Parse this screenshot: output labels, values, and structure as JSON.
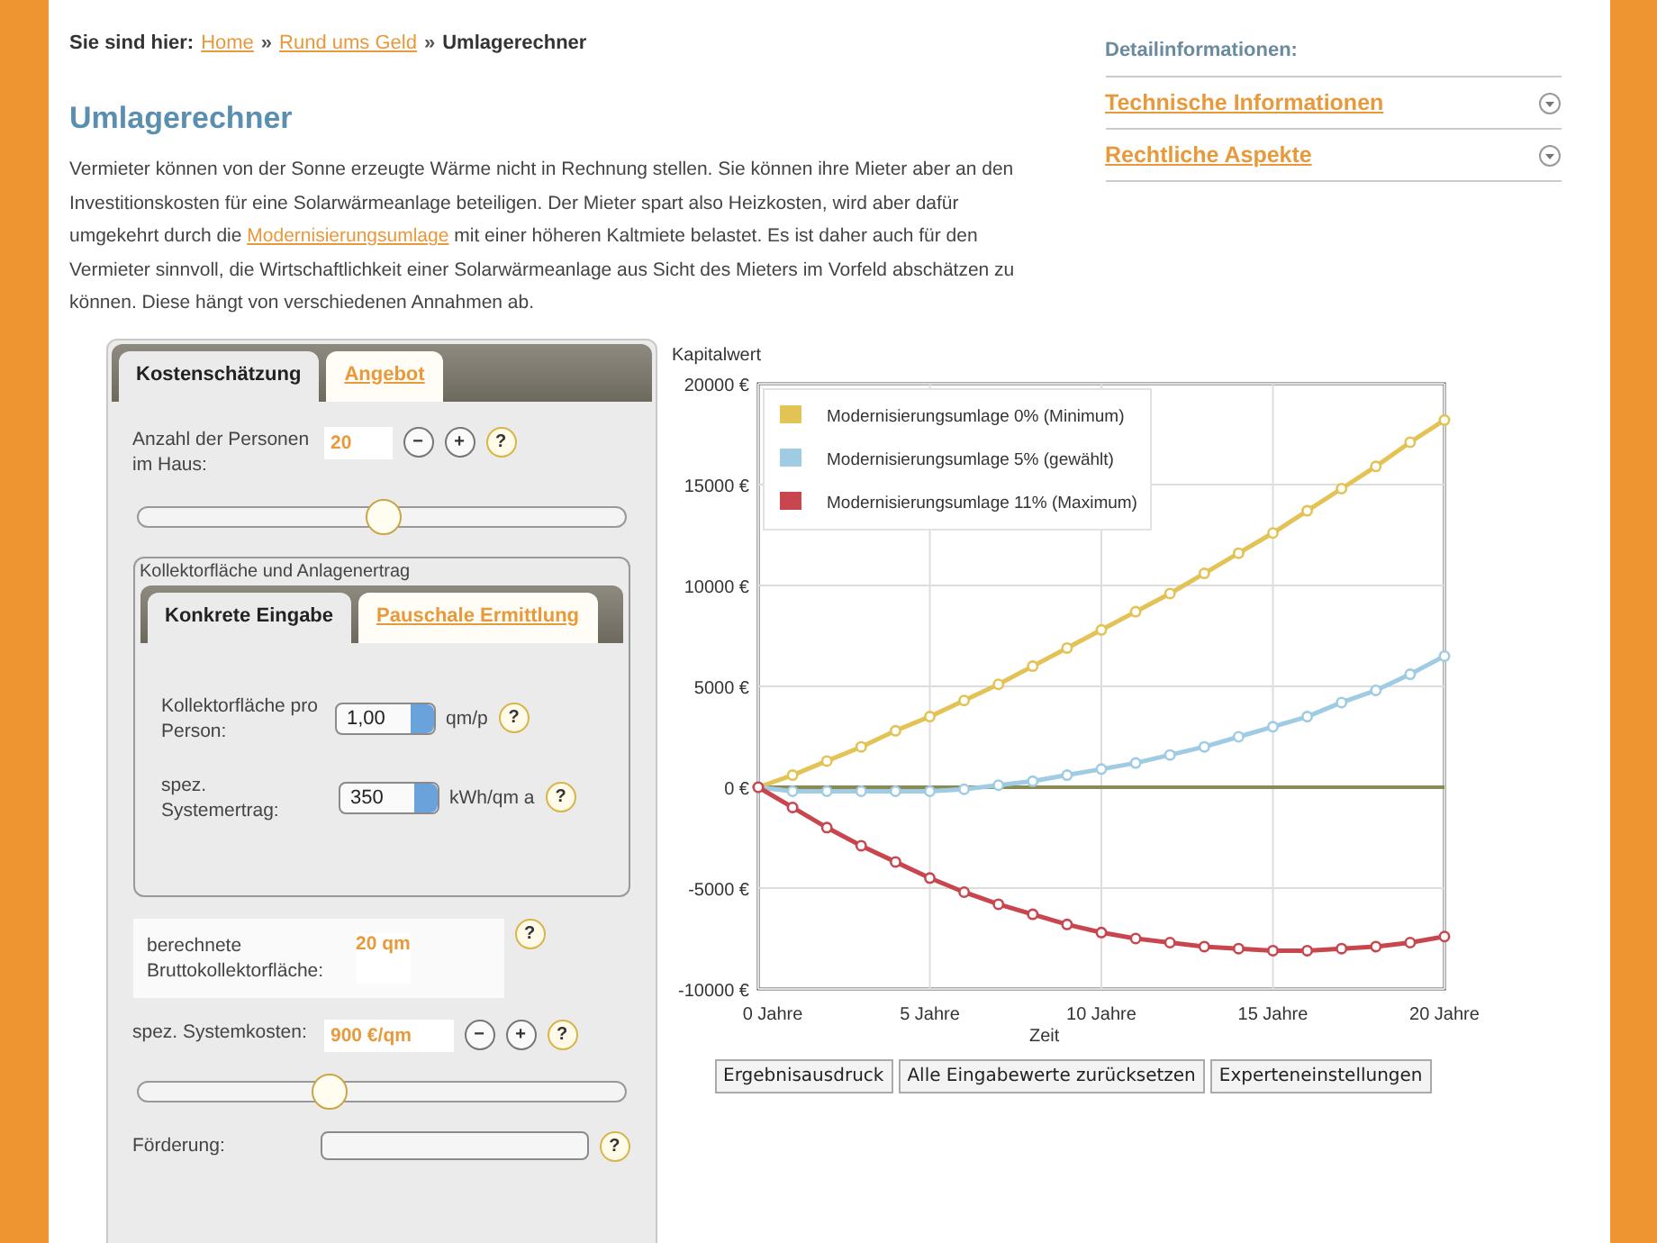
{
  "breadcrumb": {
    "label": "Sie sind hier:",
    "items": [
      {
        "text": "Home",
        "kind": "link"
      },
      {
        "text": "»",
        "kind": "separator"
      },
      {
        "text": "Rund ums Geld",
        "kind": "link"
      },
      {
        "text": "»",
        "kind": "separator"
      },
      {
        "text": "Umlagerechner",
        "kind": "current"
      }
    ]
  },
  "title": "Umlagerechner",
  "intro": [
    {
      "text": "Vermieter können von der Sonne erzeugte Wärme nicht in Rechnung stellen. Sie können ihre Mieter aber an den Investitionskosten für eine Solarwärmeanlage beteiligen. Der Mieter spart also Heizkosten, wird aber dafür umgekehrt durch die ",
      "kind": "text"
    },
    {
      "text": "Modernisierungsumlage",
      "kind": "link"
    },
    {
      "text": " mit einer höheren Kaltmiete belastet. Es ist daher auch für den Vermieter sinnvoll, die Wirtschaftlichkeit einer Solarwärmeanlage aus Sicht des Mieters im Vorfeld abschätzen zu können. Diese hängt von verschiedenen Annahmen ab.",
      "kind": "text"
    }
  ],
  "sidebar": {
    "heading": "Detailinformationen:",
    "items": [
      {
        "label": "Technische Informationen",
        "expanded": false
      },
      {
        "label": "Rechtliche Aspekte",
        "expanded": false
      }
    ]
  },
  "calculator": {
    "tabs": [
      {
        "label": "Kostenschätzung",
        "selected": true
      },
      {
        "label": "Angebot",
        "selected": false
      }
    ],
    "rows": [
      {
        "kind": "stepper",
        "label": "Anzahl der Personen im Haus:",
        "value": "20",
        "buttons": [
          "−",
          "+",
          "?"
        ]
      },
      {
        "kind": "slider",
        "level": 0.5
      },
      {
        "kind": "group",
        "legend": "Kollektorfläche und Anlagenertrag",
        "tabs": [
          {
            "label": "Konkrete Eingabe",
            "selected": true
          },
          {
            "label": "Pauschale Ermittlung",
            "selected": false
          }
        ],
        "fields": [
          {
            "label": "Kollektorfläche pro Person:",
            "value": "1,00",
            "unit": "qm/p",
            "help": "?"
          },
          {
            "label": "spez. Systemertrag:",
            "value": "350",
            "unit": "kWh/qm a",
            "help": "?"
          }
        ]
      },
      {
        "kind": "result",
        "label": "berechnete Bruttokollektorfläche:",
        "value": "20 qm",
        "buttons": [
          "?"
        ]
      },
      {
        "kind": "stepper",
        "label": "spez. Systemkosten:",
        "value": "900 €/qm",
        "buttons": [
          "−",
          "+",
          "?"
        ]
      },
      {
        "kind": "slider",
        "level": 0.39
      },
      {
        "kind": "select",
        "label": "Förderung:",
        "buttons": [
          "?"
        ]
      }
    ]
  },
  "chart": {
    "chart_data": {
      "type": "line",
      "ylabel": "Kapitalwert",
      "xlabel": "Zeit",
      "x": [
        0,
        1,
        2,
        3,
        4,
        5,
        6,
        7,
        8,
        9,
        10,
        11,
        12,
        13,
        14,
        15,
        16,
        17,
        18,
        19,
        20
      ],
      "xticks": [
        {
          "value": 0,
          "label": "0 Jahre"
        },
        {
          "value": 5,
          "label": "5 Jahre"
        },
        {
          "value": 10,
          "label": "10 Jahre"
        },
        {
          "value": 15,
          "label": "15 Jahre"
        },
        {
          "value": 20,
          "label": "20 Jahre"
        }
      ],
      "yticks": [
        {
          "value": -10000,
          "label": "-10000 €"
        },
        {
          "value": -5000,
          "label": "-5000 €"
        },
        {
          "value": 0,
          "label": "0 €"
        },
        {
          "value": 5000,
          "label": "5000 €"
        },
        {
          "value": 10000,
          "label": "10000 €"
        },
        {
          "value": 15000,
          "label": "15000 €"
        },
        {
          "value": 20000,
          "label": "20000 €"
        }
      ],
      "ylim": [
        -10000,
        20000
      ],
      "xlim": [
        0,
        20
      ],
      "grid": true,
      "legend": true,
      "ref_lines": [
        {
          "axis": "y",
          "value": 0,
          "color": "#8a8a55"
        }
      ],
      "series": [
        {
          "name": "Modernisierungsumlage 0% (Minimum)",
          "color": "#e3c256",
          "marker": "circle",
          "values": [
            0,
            600,
            1300,
            2000,
            2800,
            3500,
            4300,
            5100,
            6000,
            6900,
            7800,
            8700,
            9600,
            10600,
            11600,
            12600,
            13700,
            14800,
            15900,
            17100,
            18200
          ]
        },
        {
          "name": "Modernisierungsumlage 5% (gewählt)",
          "color": "#9fcbe3",
          "marker": "circle",
          "values": [
            0,
            -200,
            -200,
            -200,
            -200,
            -200,
            -100,
            100,
            300,
            600,
            900,
            1200,
            1600,
            2000,
            2500,
            3000,
            3500,
            4200,
            4800,
            5600,
            6500
          ]
        },
        {
          "name": "Modernisierungsumlage 11% (Maximum)",
          "color": "#c8474f",
          "marker": "circle",
          "values": [
            0,
            -1000,
            -2000,
            -2900,
            -3700,
            -4500,
            -5200,
            -5800,
            -6300,
            -6800,
            -7200,
            -7500,
            -7700,
            -7900,
            -8000,
            -8100,
            -8100,
            -8000,
            -7900,
            -7700,
            -7400
          ]
        }
      ]
    },
    "buttons": [
      "Ergebnisausdruck",
      "Alle Eingabewerte zurücksetzen",
      "Experteneinstellungen"
    ]
  }
}
